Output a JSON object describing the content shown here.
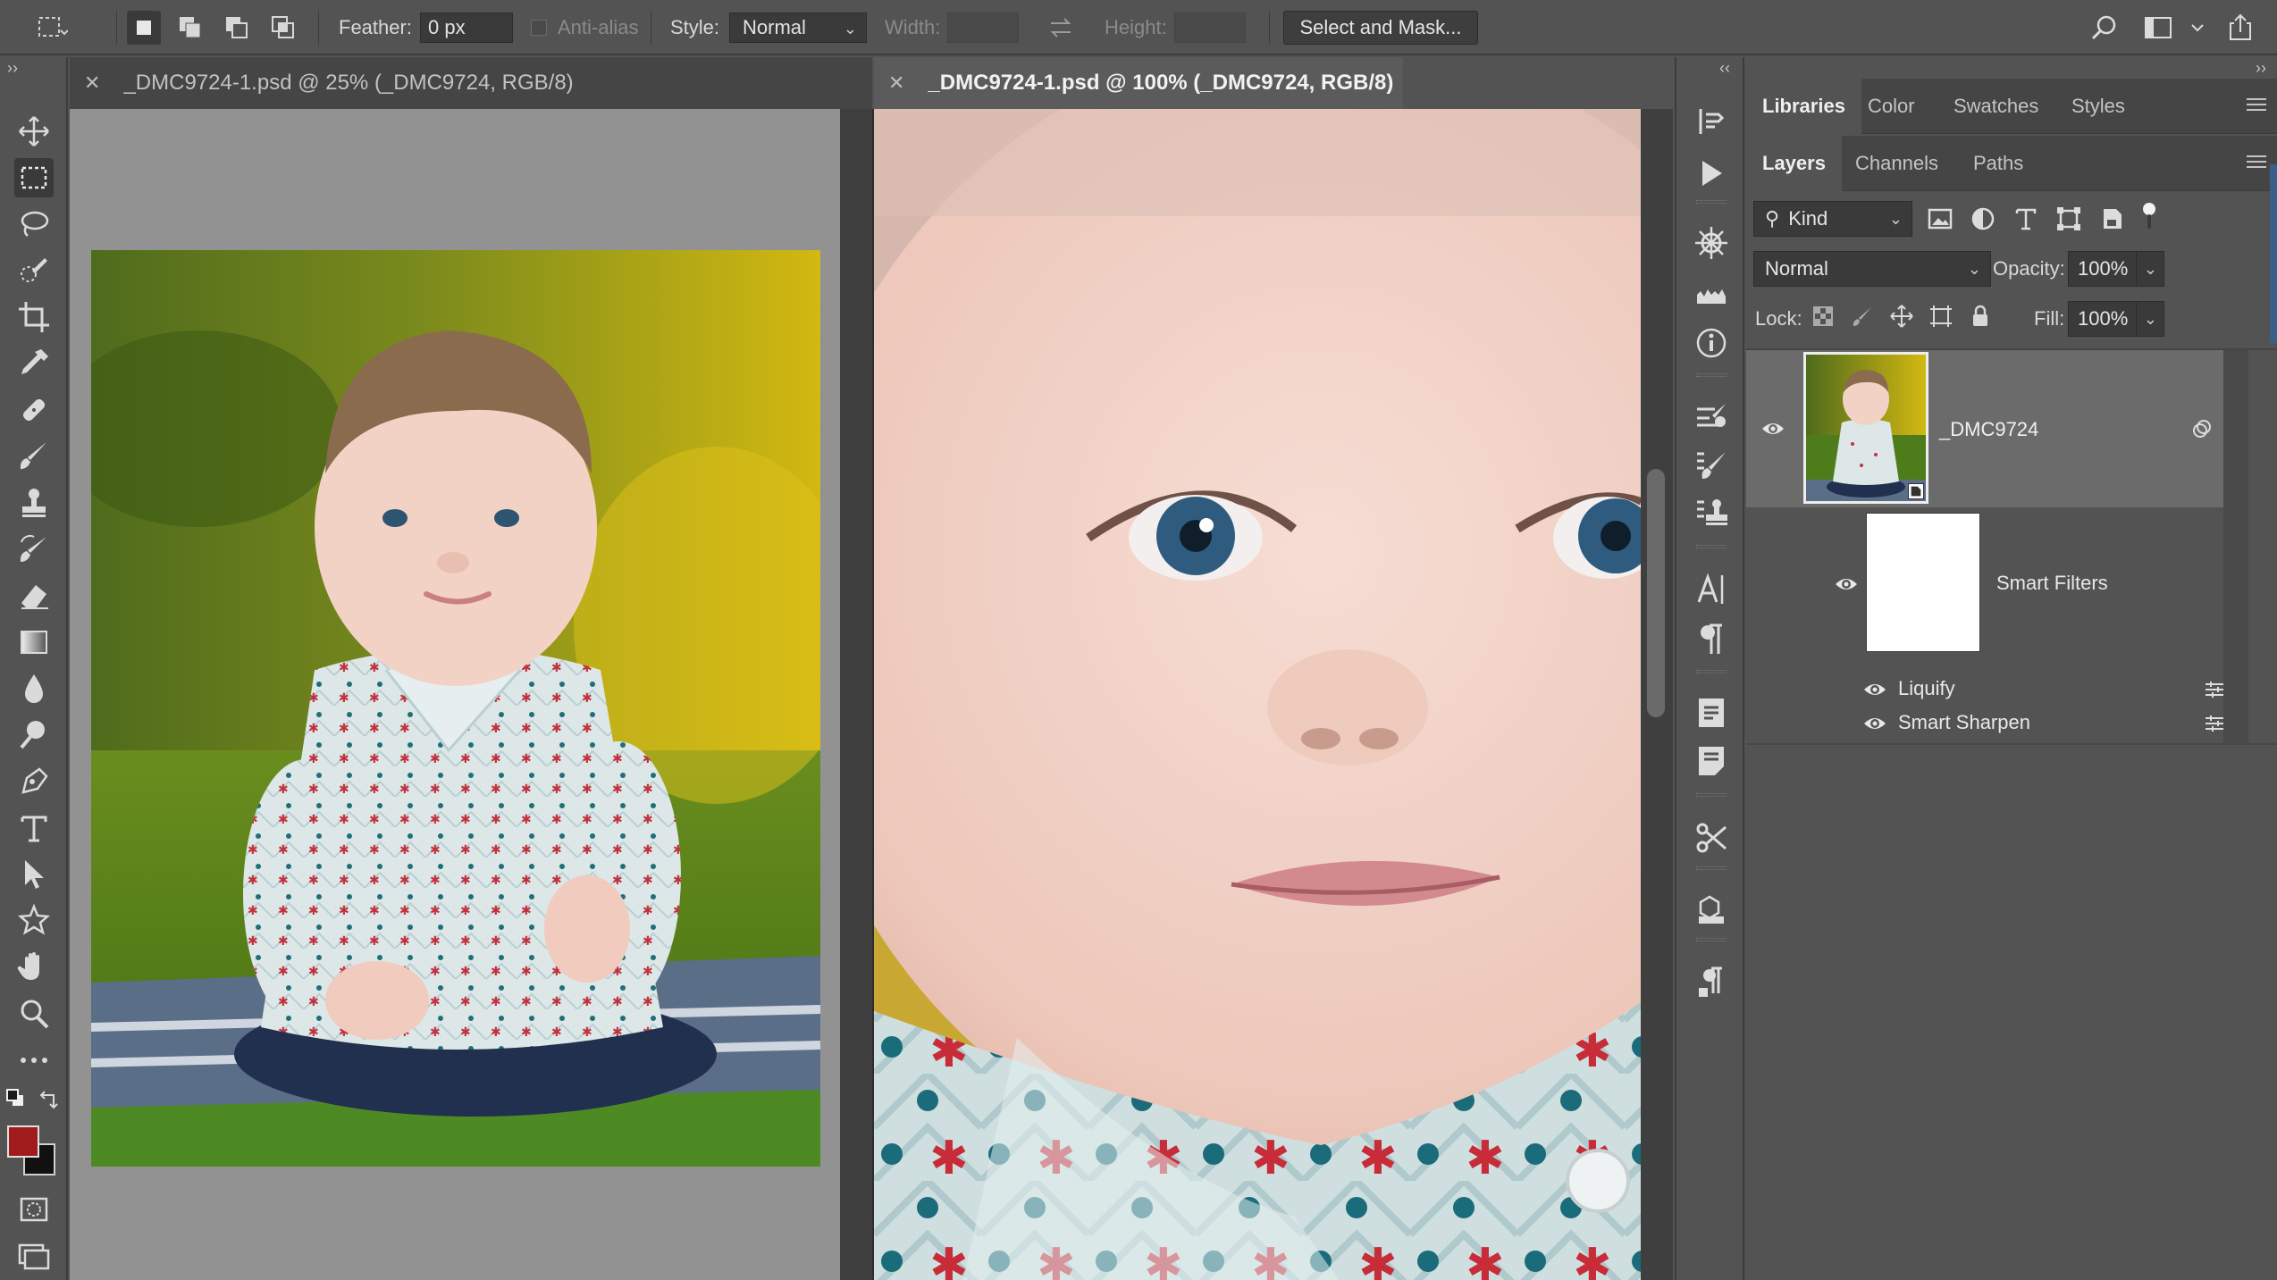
{
  "options_bar": {
    "feather_label": "Feather:",
    "feather_value": "0 px",
    "antialias_label": "Anti-alias",
    "style_label": "Style:",
    "style_value": "Normal",
    "width_label": "Width:",
    "height_label": "Height:",
    "select_mask_button": "Select and Mask..."
  },
  "documents": [
    {
      "title": "_DMC9724-1.psd @ 25% (_DMC9724, RGB/8)",
      "active": false
    },
    {
      "title": "_DMC9724-1.psd @ 100% (_DMC9724, RGB/8)",
      "active": true
    }
  ],
  "panel_top": {
    "tabs": [
      "Libraries",
      "Color",
      "Swatches",
      "Styles"
    ],
    "active": "Libraries"
  },
  "layers_panel": {
    "tabs": [
      "Layers",
      "Channels",
      "Paths"
    ],
    "active": "Layers",
    "filter_kind": "Kind",
    "blend_mode": "Normal",
    "opacity_label": "Opacity:",
    "opacity_value": "100%",
    "lock_label": "Lock:",
    "fill_label": "Fill:",
    "fill_value": "100%",
    "layer_name": "_DMC9724",
    "smart_filters_label": "Smart Filters",
    "filters": [
      "Liquify",
      "Smart Sharpen"
    ]
  },
  "colors": {
    "foreground": "#a01c1c",
    "background": "#111111",
    "ui_bg": "#535353",
    "canvas_bg": "#929292"
  }
}
